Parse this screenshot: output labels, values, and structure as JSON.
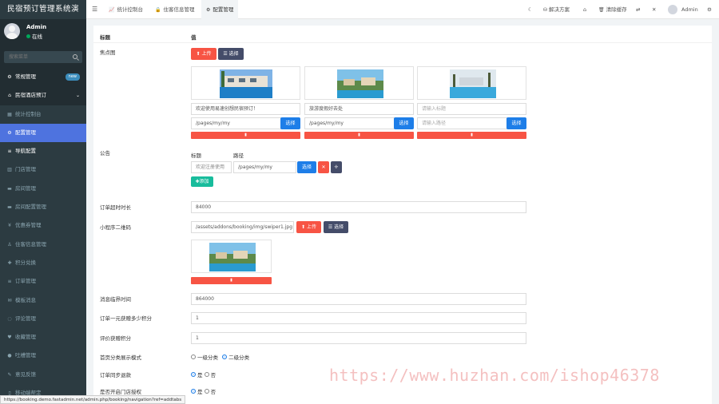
{
  "app": {
    "title": "民宿预订管理系统演"
  },
  "user": {
    "name": "Admin",
    "status": "在线"
  },
  "search": {
    "placeholder": "搜索菜单"
  },
  "sidebar": {
    "items": [
      {
        "label": "常规管理",
        "icon": "gears-icon",
        "badge": "new"
      },
      {
        "label": "民宿酒店预订",
        "icon": "home-icon"
      },
      {
        "label": "统计控制台",
        "icon": "chart-icon"
      },
      {
        "label": "配置管理",
        "icon": "gear-icon"
      },
      {
        "label": "导航配置",
        "icon": "list-icon"
      },
      {
        "label": "门店管理",
        "icon": "building-icon"
      },
      {
        "label": "房间管理",
        "icon": "bed-icon"
      },
      {
        "label": "房间配置管理",
        "icon": "bed-icon"
      },
      {
        "label": "优惠券管理",
        "icon": "yen-icon"
      },
      {
        "label": "住客信息管理",
        "icon": "user-lock-icon"
      },
      {
        "label": "积分兑换",
        "icon": "gift-icon"
      },
      {
        "label": "订单管理",
        "icon": "list-icon"
      },
      {
        "label": "模板消息",
        "icon": "mail-icon"
      },
      {
        "label": "评论管理",
        "icon": "comment-icon"
      },
      {
        "label": "收藏管理",
        "icon": "heart-icon"
      },
      {
        "label": "吐槽管理",
        "icon": "chat-icon"
      },
      {
        "label": "意见反馈",
        "icon": "edit-icon"
      },
      {
        "label": "移动端帮定",
        "icon": "mobile-icon"
      }
    ]
  },
  "topbar": {
    "tabs": [
      {
        "label": "统计控制台",
        "icon": "chart-icon"
      },
      {
        "label": "住客信息管理",
        "icon": "lock-icon"
      },
      {
        "label": "配置管理",
        "icon": "gear-icon"
      }
    ],
    "solution": "解决方案",
    "clear_cache": "清除缓存",
    "admin": "Admin"
  },
  "form": {
    "header_title": "标题",
    "header_value": "值",
    "focus_label": "焦点图",
    "upload": "上传",
    "choose": "选择",
    "slides": [
      {
        "title": "欢迎使用易速创想民宿预订！",
        "title_ph": "",
        "path": "/pages/my/my",
        "path_ph": ""
      },
      {
        "title": "旅游度假好去处",
        "title_ph": "",
        "path": "/pages/my/my",
        "path_ph": ""
      },
      {
        "title": "",
        "title_ph": "请输入标题",
        "path": "",
        "path_ph": "请输入路径"
      }
    ],
    "notice_label": "公告",
    "notice_col_title": "标题",
    "notice_col_path": "路径",
    "notice_title": "欢迎注册使用",
    "notice_path": "/pages/my/my",
    "add": "添加",
    "timeout_label": "订单超时时长",
    "timeout_value": "84000",
    "qrcode_label": "小程序二维码",
    "qrcode_path": "/assets/addons/booking/img/swiper1.jpg",
    "msg_time_label": "消息临界时间",
    "msg_time_value": "864000",
    "points_per_yuan_label": "订单一元获赠多少积分",
    "points_per_yuan_value": "1",
    "review_points_label": "评价获赠积分",
    "review_points_value": "1",
    "category_mode_label": "首页分类展示模式",
    "category_opt1": "一级分类",
    "category_opt2": "二级分类",
    "sync_refund_label": "订单同步退款",
    "auth_label": "是否开启门店授权",
    "yes": "是",
    "no": "否"
  },
  "statusbar": {
    "url": "https://booking.demo.fastadmin.net/admin.php/booking/navigation?ref=addtabs"
  },
  "watermark": "https://www.huzhan.com/ishop46378"
}
